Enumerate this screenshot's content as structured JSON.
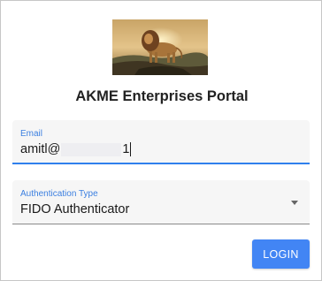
{
  "portal": {
    "title": "AKME Enterprises Portal",
    "logo_icon": "lion-logo-icon"
  },
  "email_field": {
    "label": "Email",
    "value_prefix": "amitl@",
    "value_suffix": "1"
  },
  "auth_field": {
    "label": "Authentication Type",
    "selected": "FIDO Authenticator"
  },
  "actions": {
    "login_label": "LOGIN"
  },
  "colors": {
    "accent": "#4285f4",
    "label": "#3b7fe0",
    "focus_underline": "#2f80ed"
  }
}
